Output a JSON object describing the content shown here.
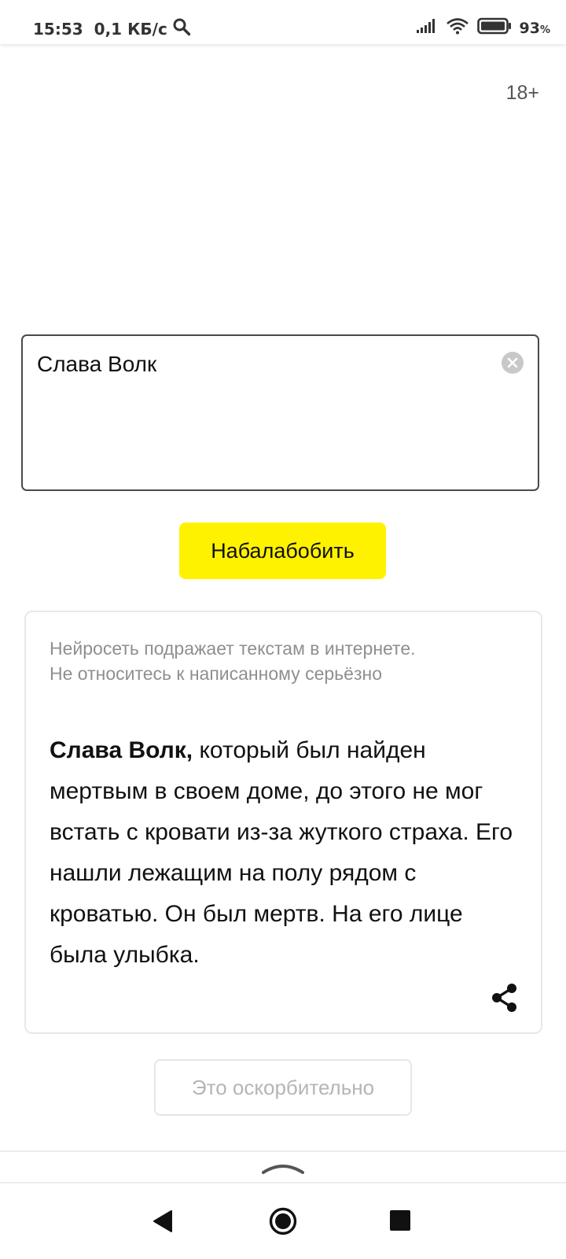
{
  "status_bar": {
    "time": "15:53",
    "network_speed": "0,1 КБ/с",
    "battery_percent": "93",
    "battery_percent_sign": "%"
  },
  "header": {
    "age_rating": "18+"
  },
  "prompt_input": {
    "value": "Слава Волк"
  },
  "primary_button": {
    "label": "Набалабобить",
    "color": "#fff200"
  },
  "result": {
    "disclaimer_line1": "Нейросеть подражает текстам в интернете.",
    "disclaimer_line2": "Не относитесь к написанному серьёзно",
    "bold_prefix": "Слава Волк,",
    "body": " который был найден мертвым в своем доме, до этого не мог встать с кровати из-за жуткого страха. Его нашли лежащим на полу рядом с кроватью. Он был мертв. На его лице была улыбка."
  },
  "report_button": {
    "label": "Это оскорбительно"
  },
  "icons": [
    "search-icon",
    "signal-icon",
    "wifi-icon",
    "battery-icon",
    "clear-icon",
    "share-icon",
    "chevron-up-icon",
    "back-icon",
    "home-icon",
    "recents-icon"
  ]
}
